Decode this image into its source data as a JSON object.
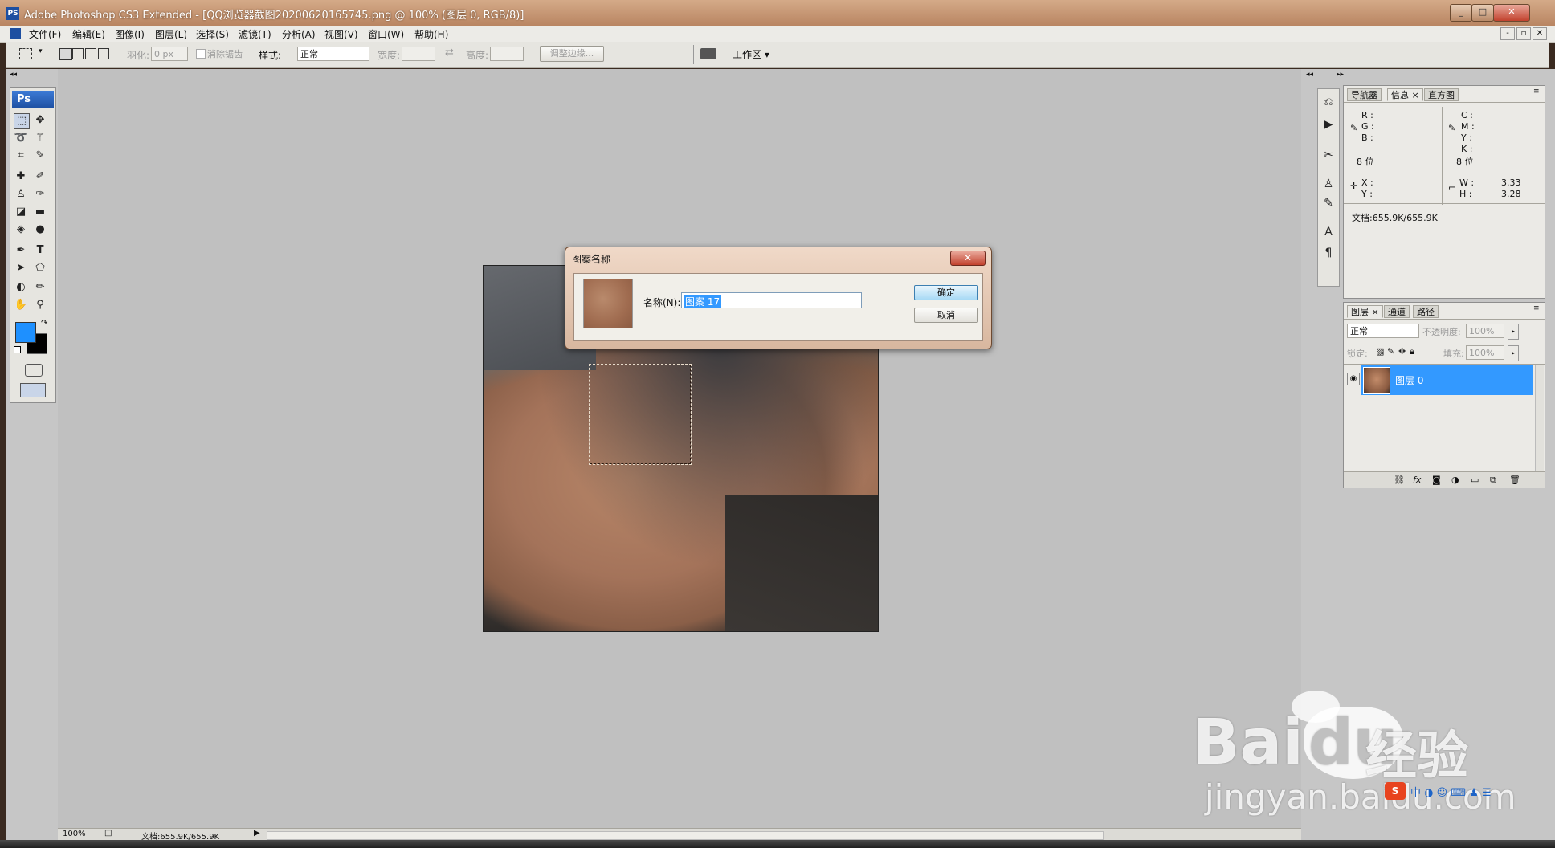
{
  "window": {
    "title": "Adobe Photoshop CS3 Extended - [QQ浏览器截图20200620165745.png @ 100% (图层 0, RGB/8)]",
    "app_icon": "PS",
    "buttons": [
      "_",
      "□",
      "✕"
    ],
    "doc_buttons": [
      "-",
      "▫",
      "✕"
    ]
  },
  "menu": [
    "文件(F)",
    "编辑(E)",
    "图像(I)",
    "图层(L)",
    "选择(S)",
    "滤镜(T)",
    "分析(A)",
    "视图(V)",
    "窗口(W)",
    "帮助(H)"
  ],
  "options": {
    "feather_label": "羽化:",
    "feather_value": "0 px",
    "antialias_label": "消除锯齿",
    "style_label": "样式:",
    "style_value": "正常",
    "width_label": "宽度:",
    "height_label": "高度:",
    "refine_button": "调整边缘...",
    "workspace_label": "工作区 ▾"
  },
  "toolbox": {
    "logo": "Ps"
  },
  "colors": {
    "foreground": "#1e90ff",
    "background": "#000000",
    "highlight": "#3399ff"
  },
  "info_panel": {
    "tabs": [
      "导航器",
      "信息 ×",
      "直方图"
    ],
    "rgb_labels": [
      "R :",
      "G :",
      "B :"
    ],
    "cmyk_labels": [
      "C :",
      "M :",
      "Y :",
      "K :"
    ],
    "bits_left": "8 位",
    "bits_right": "8 位",
    "xy_labels": [
      "X :",
      "Y :"
    ],
    "w_label": "W :",
    "w_value": "3.33",
    "h_label": "H :",
    "h_value": "3.28",
    "doc_size": "文档:655.9K/655.9K"
  },
  "layers_panel": {
    "tabs": [
      "图层 ×",
      "通道",
      "路径"
    ],
    "blend_mode": "正常",
    "opacity_label": "不透明度:",
    "opacity_value": "100%",
    "lock_label": "锁定:",
    "fill_label": "填充:",
    "fill_value": "100%",
    "layer_name": "图层 0"
  },
  "dialog": {
    "title": "图案名称",
    "close": "✕",
    "name_label": "名称(N):",
    "name_value": "图案 17",
    "ok": "确定",
    "cancel": "取消"
  },
  "status": {
    "zoom": "100%",
    "doc": "文档:655.9K/655.9K"
  },
  "watermark": {
    "brand": "Bai",
    "brand2": "du",
    "cn": "经验",
    "url": "jingyan.baidu.com"
  }
}
